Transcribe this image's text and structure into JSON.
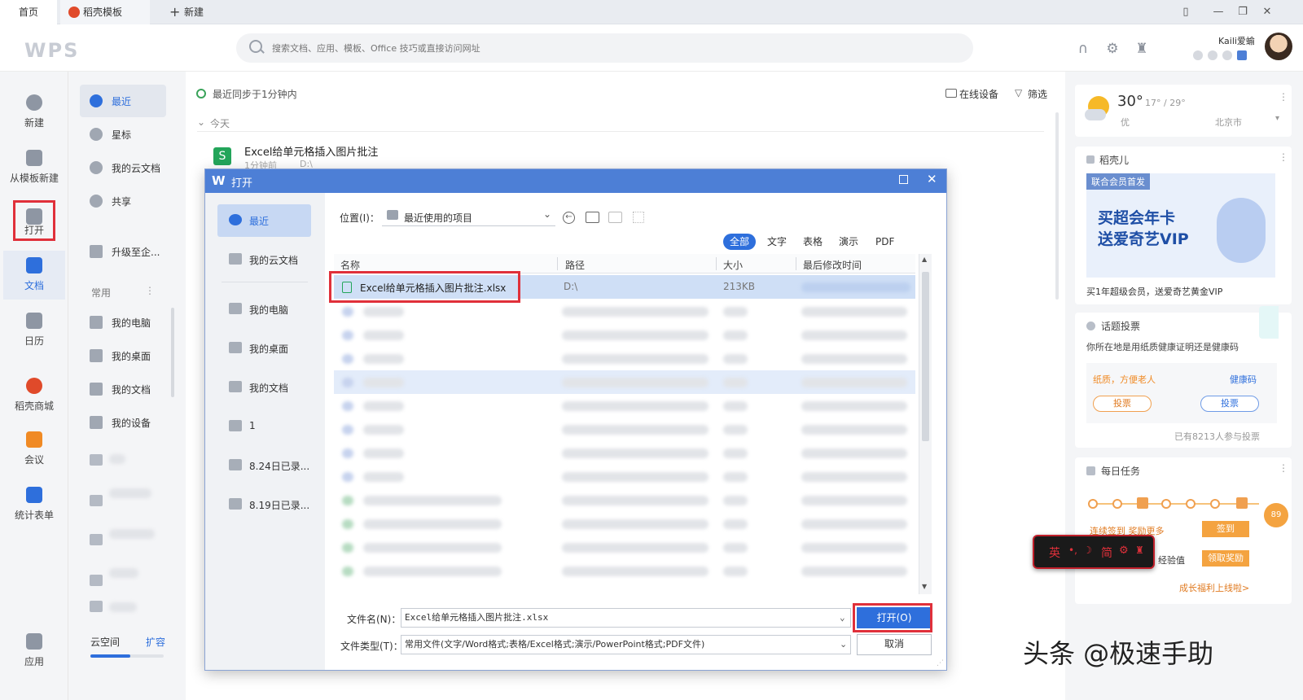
{
  "tabs": [
    {
      "label": "首页"
    },
    {
      "label": "稻壳模板"
    },
    {
      "label": "新建"
    }
  ],
  "header": {
    "logo": "WPS",
    "search_placeholder": "搜索文档、应用、模板、Office 技巧或直接访问网址",
    "username": "Kaili爱蝓"
  },
  "leftnav": [
    {
      "label": "新建",
      "icon": "plus-circle-icon"
    },
    {
      "label": "从模板新建",
      "icon": "template-icon"
    },
    {
      "label": "打开",
      "icon": "folder-open-icon"
    },
    {
      "label": "文档",
      "icon": "document-icon"
    },
    {
      "label": "日历",
      "icon": "calendar-icon"
    },
    {
      "label": "稻壳商城",
      "icon": "docer-icon"
    },
    {
      "label": "会议",
      "icon": "meeting-icon"
    },
    {
      "label": "统计表单",
      "icon": "form-icon"
    },
    {
      "label": "应用",
      "icon": "apps-icon"
    }
  ],
  "sidenav": {
    "items": [
      {
        "label": "最近"
      },
      {
        "label": "星标"
      },
      {
        "label": "我的云文档"
      },
      {
        "label": "共享"
      },
      {
        "label": "升级至企..."
      }
    ],
    "common_title": "常用",
    "common_items": [
      {
        "label": "我的电脑"
      },
      {
        "label": "我的桌面"
      },
      {
        "label": "我的文档"
      },
      {
        "label": "我的设备"
      }
    ],
    "cloud_label": "云空间",
    "expand_label": "扩容"
  },
  "main": {
    "sync_text": "最近同步于1分钟内",
    "online_devices": "在线设备",
    "filter": "筛选",
    "today": "今天",
    "recent_file": {
      "name": "Excel给单元格插入图片批注",
      "time": "1分钟前",
      "path": "D:\\"
    }
  },
  "right": {
    "weather": {
      "temp": "30°",
      "range": "17° / 29°",
      "quality": "优",
      "city": "北京市"
    },
    "docer_title": "稻壳儿",
    "promo_tag": "联合会员首发",
    "promo_headline_1": "买超会年卡",
    "promo_headline_2": "送爱奇艺VIP",
    "promo_caption": "买1年超级会员，送爱奇艺黄金VIP",
    "vote_title": "话题投票",
    "vote_question": "你所在地是用纸质健康证明还是健康码",
    "vote_left": "纸质，方便老人",
    "vote_right": "健康码",
    "vote_btn": "投票",
    "vote_count": "已有8213人参与投票",
    "task_title": "每日任务",
    "task_text": "连续签到 奖励更多",
    "sign_btn": "签到",
    "exp_label": "经验值",
    "claim_btn": "领取奖励",
    "growth_link": "成长福利上线啦>",
    "float_badge": "89"
  },
  "ime_bar": {
    "lang": "英",
    "mode": "简"
  },
  "dialog": {
    "title": "打开",
    "left": [
      {
        "label": "最近"
      },
      {
        "label": "我的云文档"
      },
      {
        "label": "我的电脑"
      },
      {
        "label": "我的桌面"
      },
      {
        "label": "我的文档"
      },
      {
        "label": "1"
      },
      {
        "label": "8.24日已录..."
      },
      {
        "label": "8.19日已录..."
      }
    ],
    "location_label": "位置(I)：",
    "location_value": "最近使用的项目",
    "filter_tabs": [
      "全部",
      "文字",
      "表格",
      "演示",
      "PDF"
    ],
    "columns": [
      "名称",
      "路径",
      "大小",
      "最后修改时间"
    ],
    "selected_file": {
      "name": "Excel给单元格插入图片批注.xlsx",
      "path": "D:\\",
      "size": "213KB"
    },
    "filename_label": "文件名(N)：",
    "filename_value": "Excel给单元格插入图片批注.xlsx",
    "filetype_label": "文件类型(T)：",
    "filetype_value": "常用文件(文字/Word格式;表格/Excel格式;演示/PowerPoint格式;PDF文件)",
    "open_btn": "打开(O)",
    "cancel_btn": "取消"
  },
  "watermark": "头条 @极速手助",
  "colors": {
    "accent": "#2e6fdc",
    "highlight": "#e0303a",
    "titlebar": "#4d7fd6"
  }
}
